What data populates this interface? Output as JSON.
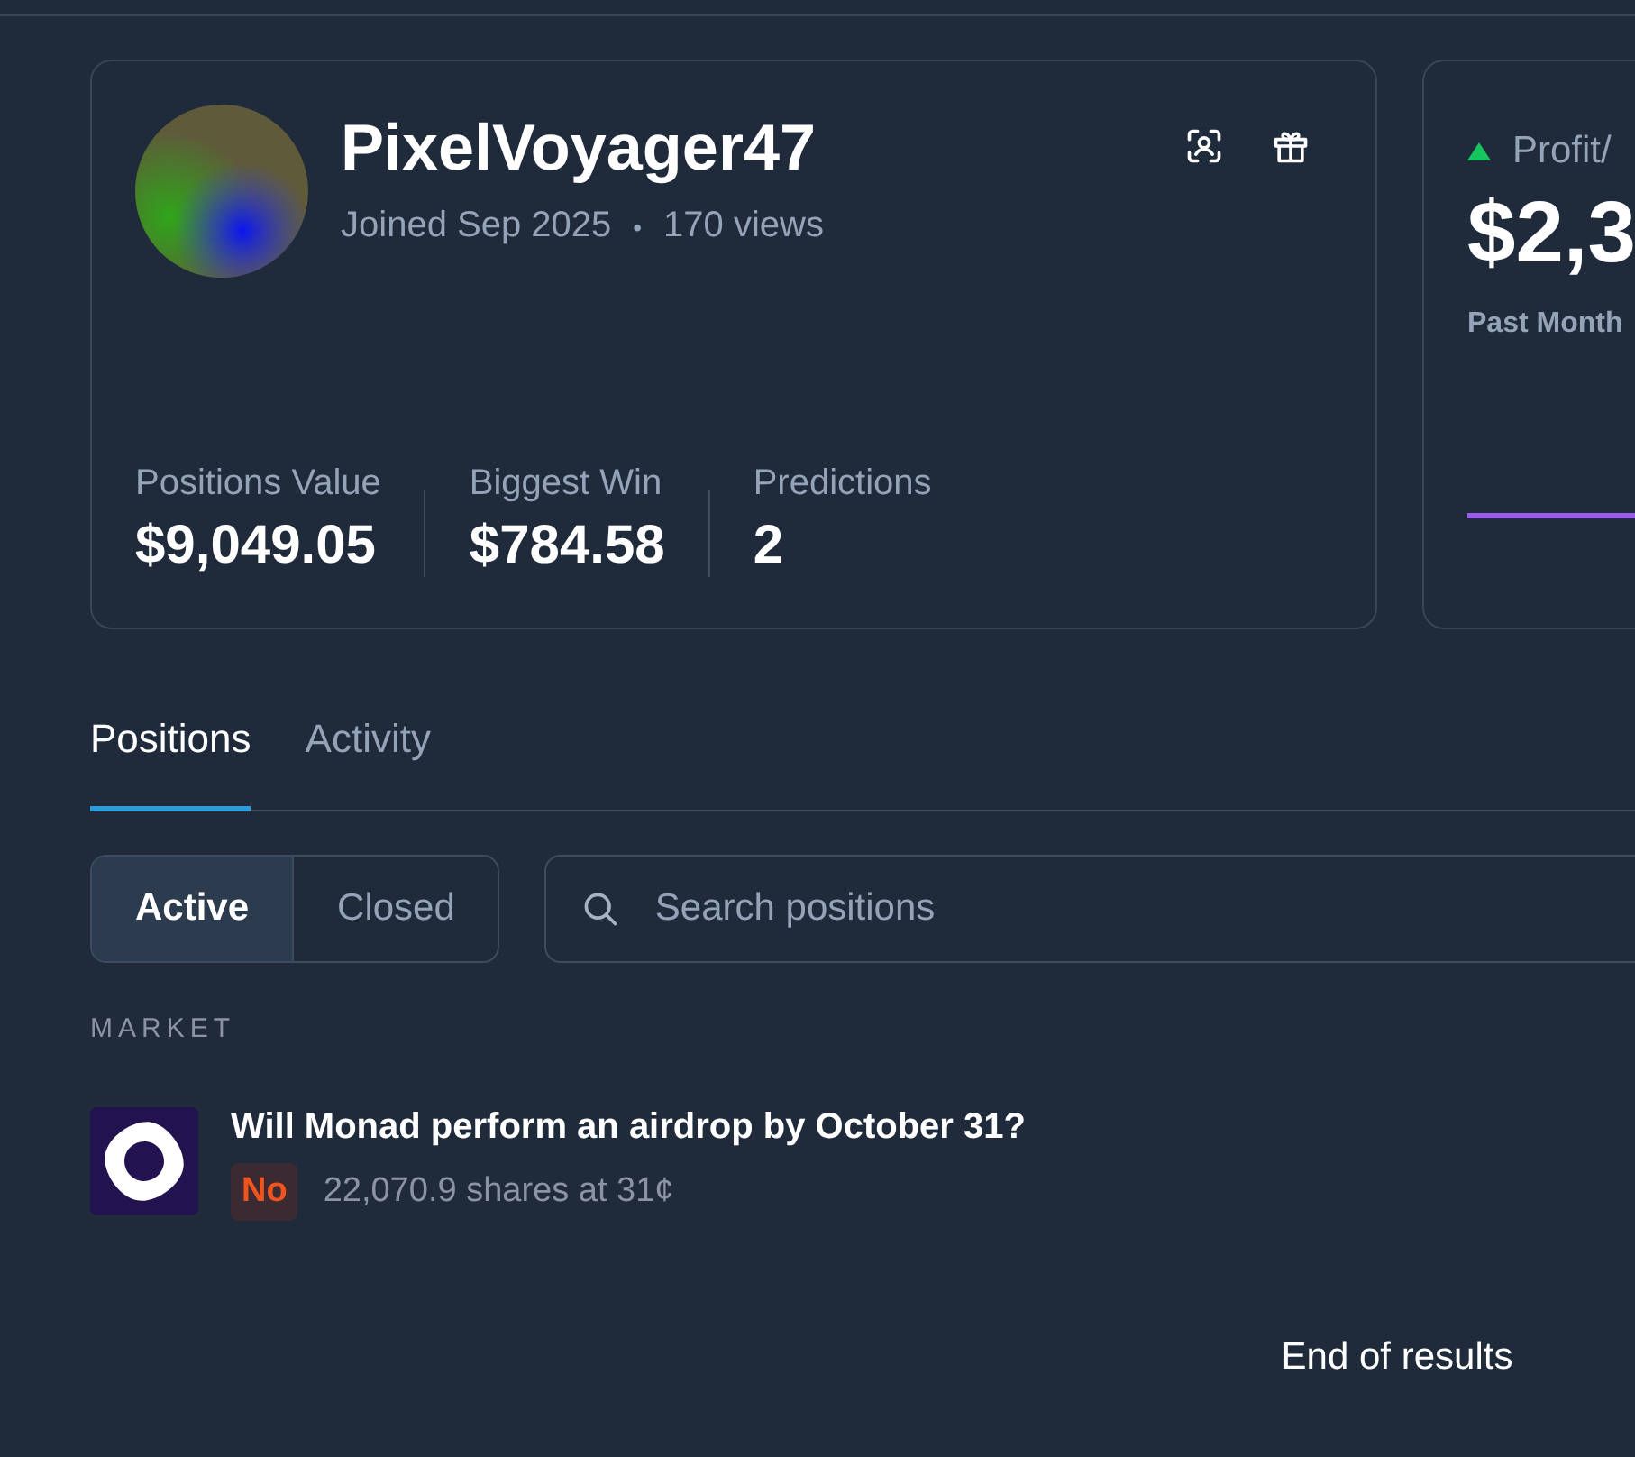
{
  "profile": {
    "username": "PixelVoyager47",
    "joined": "Joined Sep 2025",
    "separator": "•",
    "views": "170 views",
    "stats": [
      {
        "label": "Positions Value",
        "value": "$9,049.05"
      },
      {
        "label": "Biggest Win",
        "value": "$784.58"
      },
      {
        "label": "Predictions",
        "value": "2"
      }
    ]
  },
  "profit_card": {
    "label": "Profit/",
    "positive": true,
    "value": "$2,3",
    "period": "Past Month"
  },
  "tabs": [
    {
      "label": "Positions",
      "selected": true
    },
    {
      "label": "Activity",
      "selected": false
    }
  ],
  "filters": [
    {
      "label": "Active",
      "selected": true
    },
    {
      "label": "Closed",
      "selected": false
    }
  ],
  "search": {
    "placeholder": "Search positions"
  },
  "column_header": "MARKET",
  "positions": [
    {
      "title": "Will Monad perform an airdrop by October 31?",
      "outcome": "No",
      "detail": "22,070.9 shares at 31¢"
    }
  ],
  "footer": "End of results"
}
